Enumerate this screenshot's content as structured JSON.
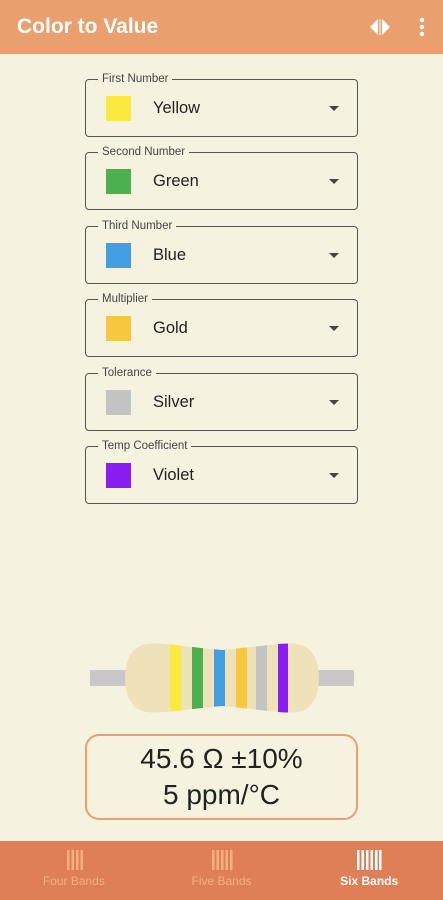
{
  "app": {
    "title": "Color to Value"
  },
  "fields": [
    {
      "label": "First Number",
      "value": "Yellow",
      "color": "#fce940"
    },
    {
      "label": "Second Number",
      "value": "Green",
      "color": "#4caf50"
    },
    {
      "label": "Third Number",
      "value": "Blue",
      "color": "#42a0e2"
    },
    {
      "label": "Multiplier",
      "value": "Gold",
      "color": "#f6c83e"
    },
    {
      "label": "Tolerance",
      "value": "Silver",
      "color": "#c4c4c4"
    },
    {
      "label": "Temp Coefficient",
      "value": "Violet",
      "color": "#8a1ef2"
    }
  ],
  "result": {
    "line1": "45.6 Ω ±10%",
    "line2": "5 ppm/°C"
  },
  "nav": [
    {
      "label": "Four Bands",
      "active": false
    },
    {
      "label": "Five Bands",
      "active": false
    },
    {
      "label": "Six Bands",
      "active": true
    }
  ],
  "colors": {
    "primary": "#e9a06e",
    "nav": "#df7f57",
    "background": "#f5f3df",
    "resistor_body": "#efe2b8",
    "lead": "#c8c8c8"
  }
}
